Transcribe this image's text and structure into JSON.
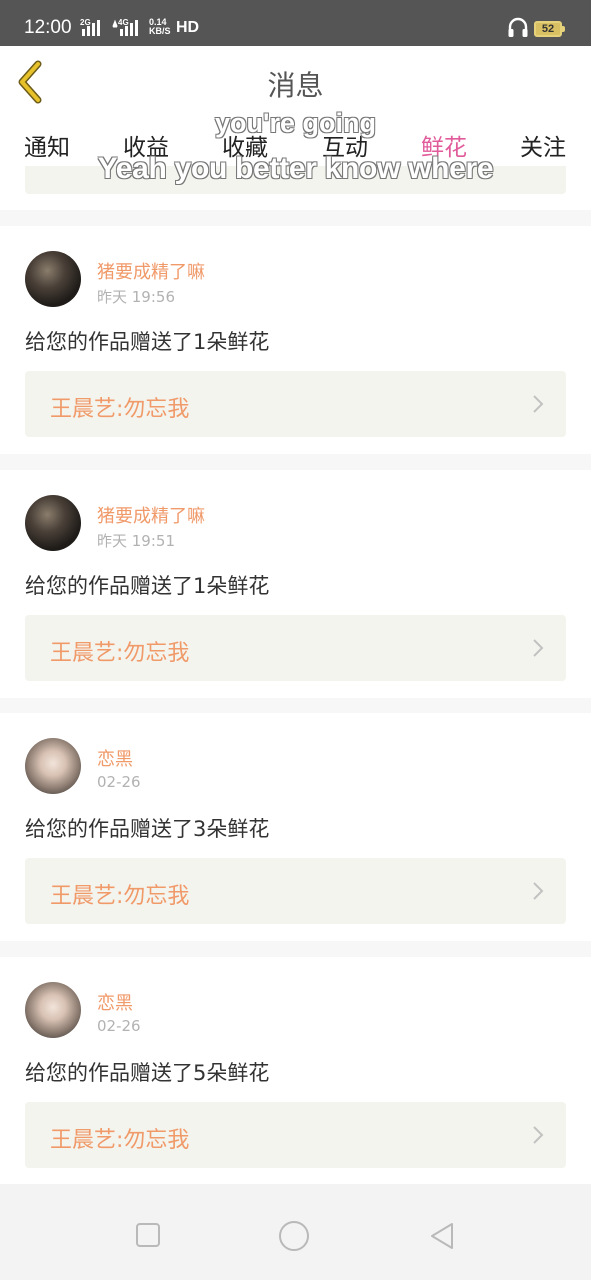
{
  "status_bar": {
    "time": "12:00",
    "network_label_1": "2G",
    "network_label_2": "4G",
    "speed_value": "0.14",
    "speed_unit": "KB/S",
    "hd_label": "HD",
    "battery_level": "52"
  },
  "header": {
    "title": "消息",
    "back_icon": "chevron-left-icon"
  },
  "tabs": [
    {
      "label": "通知",
      "active": false
    },
    {
      "label": "收益",
      "active": false
    },
    {
      "label": "收藏",
      "active": false
    },
    {
      "label": "互动",
      "active": false
    },
    {
      "label": "鲜花",
      "active": true
    },
    {
      "label": "关注",
      "active": false
    }
  ],
  "lyrics_overlay": {
    "line1": "you're going",
    "line2": "Yeah you better know where"
  },
  "notifications": [
    {
      "username": "猪要成精了嘛",
      "time": "昨天 19:56",
      "message": "给您的作品赠送了1朵鲜花",
      "work_title": "王晨艺:勿忘我",
      "avatar": "dark"
    },
    {
      "username": "猪要成精了嘛",
      "time": "昨天 19:51",
      "message": "给您的作品赠送了1朵鲜花",
      "work_title": "王晨艺:勿忘我",
      "avatar": "dark"
    },
    {
      "username": "恋黑",
      "time": "02-26",
      "message": "给您的作品赠送了3朵鲜花",
      "work_title": "王晨艺:勿忘我",
      "avatar": "light"
    },
    {
      "username": "恋黑",
      "time": "02-26",
      "message": "给您的作品赠送了5朵鲜花",
      "work_title": "王晨艺:勿忘我",
      "avatar": "light"
    }
  ],
  "colors": {
    "accent_orange": "#f09a6a",
    "active_tab_pink": "#e15b9a",
    "back_icon_gold": "#e6c12a"
  }
}
